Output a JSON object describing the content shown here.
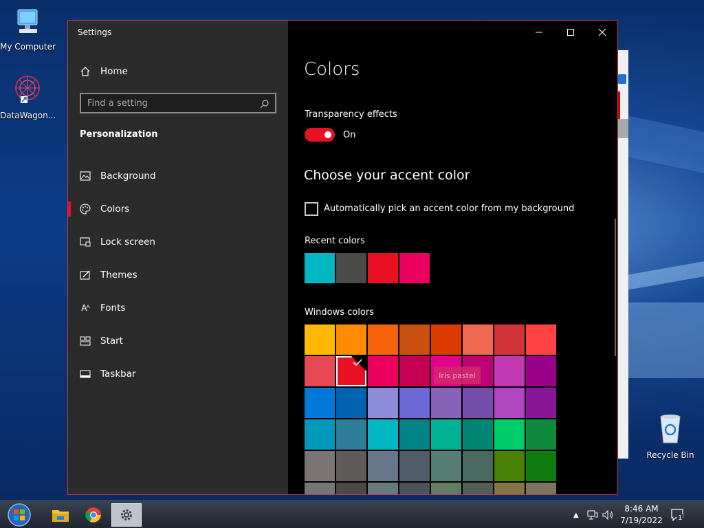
{
  "desktop": {
    "icons": [
      {
        "label": "My Computer"
      },
      {
        "label": "DataWagon..."
      },
      {
        "label": "Recycle Bin"
      }
    ]
  },
  "window": {
    "title": "Settings",
    "controls": {
      "minimize": "minimize-icon",
      "maximize": "maximize-icon",
      "close": "close-icon"
    }
  },
  "sidebar": {
    "home_label": "Home",
    "search_placeholder": "Find a setting",
    "section_heading": "Personalization",
    "items": [
      {
        "label": "Background",
        "icon": "picture-icon"
      },
      {
        "label": "Colors",
        "icon": "palette-icon",
        "active": true
      },
      {
        "label": "Lock screen",
        "icon": "lock-screen-icon"
      },
      {
        "label": "Themes",
        "icon": "brush-icon"
      },
      {
        "label": "Fonts",
        "icon": "fonts-icon"
      },
      {
        "label": "Start",
        "icon": "start-icon"
      },
      {
        "label": "Taskbar",
        "icon": "taskbar-icon"
      }
    ]
  },
  "main": {
    "title": "Colors",
    "transparency_label": "Transparency effects",
    "transparency_state": "On",
    "accent_heading": "Choose your accent color",
    "auto_pick_label": "Automatically pick an accent color from my background",
    "recent_label": "Recent colors",
    "recent_colors": [
      "#00b7c3",
      "#4c4a48",
      "#e81123",
      "#ea005e"
    ],
    "windows_label": "Windows colors",
    "windows_colors": [
      [
        "#ffb900",
        "#ff8c00",
        "#f7630c",
        "#ca5010",
        "#da3b01",
        "#ef6950",
        "#d13438",
        "#ff4343"
      ],
      [
        "#e74856",
        "#e81123",
        "#ea005e",
        "#c30052",
        "#e3008c",
        "#bf0077",
        "#c239b3",
        "#9a0089"
      ],
      [
        "#0078d7",
        "#0063b1",
        "#8e8cd8",
        "#6b69d6",
        "#8764b8",
        "#744da9",
        "#b146c2",
        "#881798"
      ],
      [
        "#0099bc",
        "#2d7d9a",
        "#00b7c3",
        "#038387",
        "#00b294",
        "#018574",
        "#00cc6a",
        "#10893e"
      ],
      [
        "#7a7574",
        "#5d5a58",
        "#68768a",
        "#515c6b",
        "#567c73",
        "#486860",
        "#498205",
        "#107c10"
      ],
      [
        "#767676",
        "#4c4a48",
        "#69797e",
        "#4a5459",
        "#647c64",
        "#525e54",
        "#847545",
        "#7e735f"
      ]
    ],
    "selected_color": "#e81123",
    "tooltip": "Iris pastel",
    "accent": "#e81123"
  },
  "taskbar": {
    "buttons": [
      "start-orb-icon",
      "file-explorer-icon",
      "chrome-icon",
      "settings-gear-icon"
    ],
    "time": "8:46 AM",
    "date": "7/19/2022",
    "notification_count": "1"
  }
}
